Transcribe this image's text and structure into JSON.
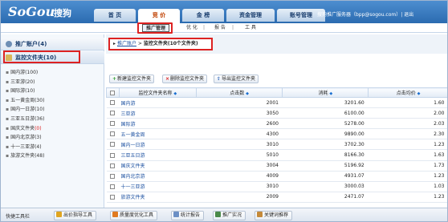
{
  "header": {
    "logo": "SoGou",
    "logo_cn": "搜狗",
    "user_line": "搜狗推广服务器（bpp@sogou.com）| 退出"
  },
  "nav_tabs": [
    {
      "label": "首 页",
      "active": false
    },
    {
      "label": "竞 价",
      "active": true
    },
    {
      "label": "金 榜",
      "active": false
    },
    {
      "label": "资金管理",
      "active": false
    },
    {
      "label": "账号管理",
      "active": false
    }
  ],
  "sub_nav": {
    "items": [
      "推广管理",
      "优 化",
      "报 告",
      "工 具"
    ],
    "separator": "|"
  },
  "sidebar": {
    "account_header": "推广账户(4)",
    "folder_header": "监控文件夹(10)",
    "folders": [
      {
        "name": "国内游",
        "count": "(100)",
        "highlight": false
      },
      {
        "name": "三亚游",
        "count": "(20)",
        "highlight": false
      },
      {
        "name": "国际游",
        "count": "(10)",
        "highlight": false
      },
      {
        "name": "五一黄金周",
        "count": "(30)",
        "highlight": false
      },
      {
        "name": "国内一日游",
        "count": "(10)",
        "highlight": false
      },
      {
        "name": "三亚五日游",
        "count": "(36)",
        "highlight": false
      },
      {
        "name": "国庆文件夹",
        "count": "(0)",
        "highlight": true
      },
      {
        "name": "国内北京游",
        "count": "(3)",
        "highlight": false
      },
      {
        "name": "十一三亚游",
        "count": "(4)",
        "highlight": false
      },
      {
        "name": "旅游文件夹",
        "count": "(48)",
        "highlight": false
      }
    ]
  },
  "breadcrumb": {
    "arrow": "▸",
    "link": "推广账户",
    "separator": ">",
    "current": "监控文件夹(10个文件夹)"
  },
  "toolbar": {
    "add": "新建监控文件夹",
    "delete": "删除监控文件夹",
    "export": "导出监控文件夹"
  },
  "table": {
    "columns": [
      "监控文件夹名称",
      "点击数",
      "消耗",
      "点击均价"
    ],
    "sort_icon": "◆",
    "rows": [
      {
        "name": "国内游",
        "clicks": "2001",
        "cost": "3201.60",
        "avg": "1.60"
      },
      {
        "name": "三亚游",
        "clicks": "3050",
        "cost": "6100.00",
        "avg": "2.00"
      },
      {
        "name": "国际游",
        "clicks": "2600",
        "cost": "5278.00",
        "avg": "2.03"
      },
      {
        "name": "五一黄金周",
        "clicks": "4300",
        "cost": "9890.00",
        "avg": "2.30"
      },
      {
        "name": "国内一日游",
        "clicks": "3010",
        "cost": "3702.30",
        "avg": "1.23"
      },
      {
        "name": "三亚五日游",
        "clicks": "5010",
        "cost": "8166.30",
        "avg": "1.63"
      },
      {
        "name": "国庆文件夹",
        "clicks": "3004",
        "cost": "5196.92",
        "avg": "1.73"
      },
      {
        "name": "国内北京游",
        "clicks": "4009",
        "cost": "4931.07",
        "avg": "1.23"
      },
      {
        "name": "十一三亚游",
        "clicks": "3010",
        "cost": "3000.03",
        "avg": "1.03"
      },
      {
        "name": "旅游文件夹",
        "clicks": "2009",
        "cost": "2471.07",
        "avg": "1.23"
      }
    ]
  },
  "bottom_bar": {
    "label": "快捷工具栏",
    "buttons": [
      "出价指导工具",
      "质量度优化工具",
      "统计报告",
      "推广实况",
      "关键词推荐"
    ]
  },
  "colors": {
    "header_blue": "#2b6bb0",
    "highlight_red": "#d22",
    "link_blue": "#1a4fa0",
    "active_tab_text": "#c04000"
  }
}
